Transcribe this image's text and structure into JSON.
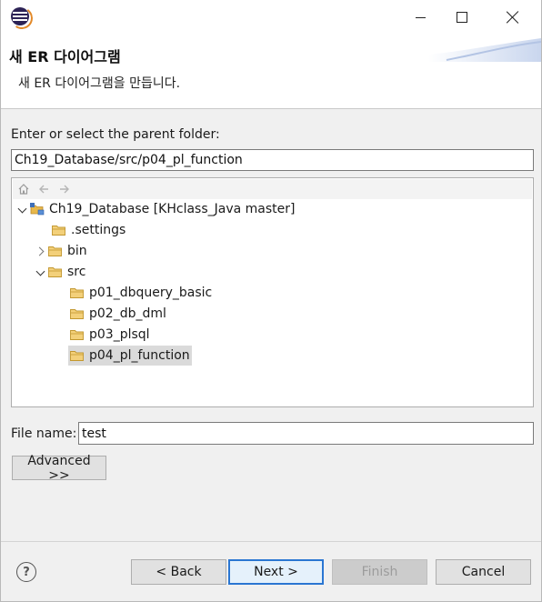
{
  "window": {
    "title_icon": "eclipse-app-icon",
    "controls": [
      "minimize-icon",
      "maximize-icon",
      "close-icon"
    ]
  },
  "header": {
    "title": "새 ER 다이어그램",
    "description": "새 ER 다이어그램을 만듭니다."
  },
  "folder": {
    "label": "Enter or select the parent folder:",
    "path_value": "Ch19_Database/src/p04_pl_function"
  },
  "tree": {
    "toolbar_icons": [
      "home-icon",
      "back-arrow-icon",
      "forward-arrow-icon"
    ],
    "project": "Ch19_Database [KHclass_Java master]",
    "settings": ".settings",
    "bin": "bin",
    "src": "src",
    "packages": [
      "p01_dbquery_basic",
      "p02_db_dml",
      "p03_plsql",
      "p04_pl_function"
    ],
    "selected": "p04_pl_function"
  },
  "file": {
    "label": "File name:",
    "value": "test"
  },
  "buttons": {
    "advanced": "Advanced >>",
    "help": "?",
    "back": "< Back",
    "next": "Next >",
    "finish": "Finish",
    "cancel": "Cancel"
  },
  "colors": {
    "folder": "#e8b84a",
    "selection": "#dadada",
    "default_button_border": "#2a76d2"
  }
}
